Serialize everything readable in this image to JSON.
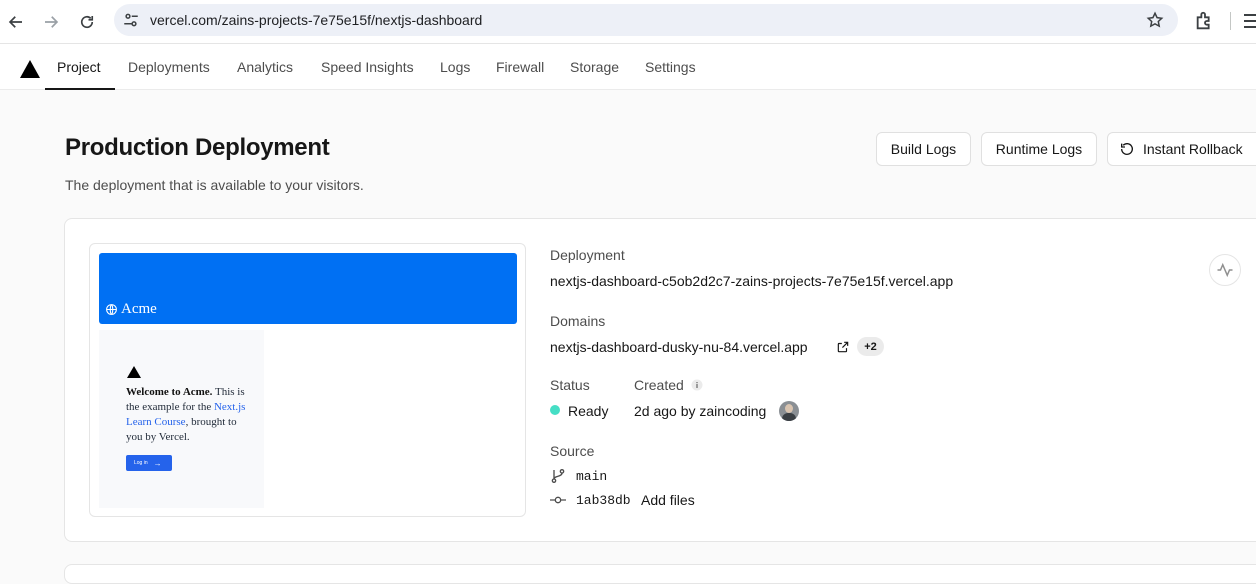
{
  "browser": {
    "url": "vercel.com/zains-projects-7e75e15f/nextjs-dashboard"
  },
  "topnav": {
    "tabs": [
      {
        "label": "Project",
        "active": true
      },
      {
        "label": "Deployments"
      },
      {
        "label": "Analytics"
      },
      {
        "label": "Speed Insights"
      },
      {
        "label": "Logs"
      },
      {
        "label": "Firewall"
      },
      {
        "label": "Storage"
      },
      {
        "label": "Settings"
      }
    ]
  },
  "header": {
    "title": "Production Deployment",
    "subtitle": "The deployment that is available to your visitors.",
    "buttons": {
      "build_logs": "Build Logs",
      "runtime_logs": "Runtime Logs",
      "instant_rollback": "Instant Rollback"
    }
  },
  "preview": {
    "brand": "Acme",
    "welcome_bold": "Welcome to Acme.",
    "welcome_rest": " This is the example for the ",
    "link": "Next.js Learn Course",
    "welcome_end": ", brought to you by Vercel.",
    "button": "Log in"
  },
  "details": {
    "deployment_label": "Deployment",
    "deployment_value": "nextjs-dashboard-c5ob2d2c7-zains-projects-7e75e15f.vercel.app",
    "domains_label": "Domains",
    "domains_value": "nextjs-dashboard-dusky-nu-84.vercel.app",
    "domains_extra": "+2",
    "status_label": "Status",
    "status_value": "Ready",
    "created_label": "Created",
    "created_value": "2d ago by zaincoding",
    "source_label": "Source",
    "branch": "main",
    "commit_hash": "1ab38db",
    "commit_message": "Add files"
  },
  "colors": {
    "accent": "#0070f3",
    "ready": "#45dec5",
    "text": "#171717",
    "muted": "#4d4d4d"
  },
  "icons": [
    "back-arrow-icon",
    "forward-arrow-icon",
    "reload-icon",
    "site-settings-icon",
    "star-icon",
    "extensions-icon",
    "vercel-logo-icon",
    "rollback-icon",
    "external-link-icon",
    "info-icon",
    "git-branch-icon",
    "git-commit-icon",
    "activity-icon"
  ]
}
